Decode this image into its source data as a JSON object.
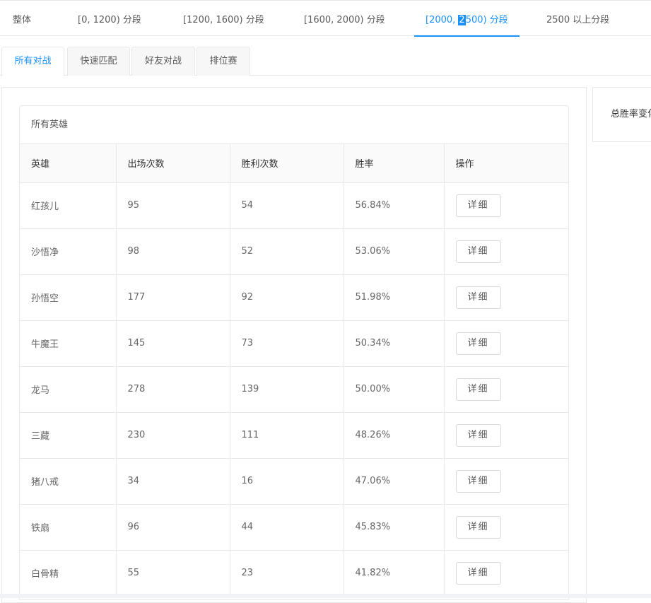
{
  "rank_tabs": [
    {
      "label": "整体"
    },
    {
      "label": "[0, 1200) 分段"
    },
    {
      "label": "[1200, 1600) 分段"
    },
    {
      "label": "[1600, 2000) 分段"
    },
    {
      "label_pre": "[2000, ",
      "label_sel": "2",
      "label_post": "500) 分段",
      "active": true
    },
    {
      "label": "2500 以上分段"
    }
  ],
  "mode_tabs": [
    {
      "label": "所有对战",
      "active": true
    },
    {
      "label": "快速匹配"
    },
    {
      "label": "好友对战"
    },
    {
      "label": "排位赛"
    }
  ],
  "hero_table": {
    "title": "所有英雄",
    "columns": [
      "英雄",
      "出场次数",
      "胜利次数",
      "胜率",
      "操作"
    ],
    "rows": [
      {
        "hero": "红孩儿",
        "games": "95",
        "wins": "54",
        "rate": "56.84%",
        "action": "详细"
      },
      {
        "hero": "沙悟净",
        "games": "98",
        "wins": "52",
        "rate": "53.06%",
        "action": "详细"
      },
      {
        "hero": "孙悟空",
        "games": "177",
        "wins": "92",
        "rate": "51.98%",
        "action": "详细"
      },
      {
        "hero": "牛魔王",
        "games": "145",
        "wins": "73",
        "rate": "50.34%",
        "action": "详细"
      },
      {
        "hero": "龙马",
        "games": "278",
        "wins": "139",
        "rate": "50.00%",
        "action": "详细"
      },
      {
        "hero": "三藏",
        "games": "230",
        "wins": "111",
        "rate": "48.26%",
        "action": "详细"
      },
      {
        "hero": "猪八戒",
        "games": "34",
        "wins": "16",
        "rate": "47.06%",
        "action": "详细"
      },
      {
        "hero": "铁扇",
        "games": "96",
        "wins": "44",
        "rate": "45.83%",
        "action": "详细"
      },
      {
        "hero": "白骨精",
        "games": "55",
        "wins": "23",
        "rate": "41.82%",
        "action": "详细"
      }
    ]
  },
  "side_card": {
    "title": "总胜率变化"
  },
  "colors": {
    "accent": "#1890ff",
    "border": "#e8e8e8",
    "header_bg": "#fafafa"
  }
}
